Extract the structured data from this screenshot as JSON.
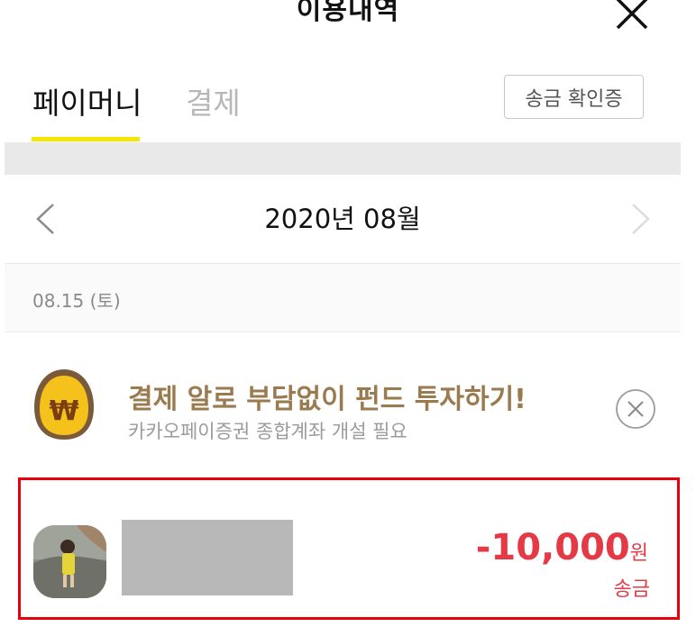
{
  "header": {
    "title": "이용내역"
  },
  "tabs": [
    {
      "label": "페이머니",
      "active": true
    },
    {
      "label": "결제",
      "active": false
    }
  ],
  "receipt_button": "송금 확인증",
  "month": {
    "label": "2020년 08월"
  },
  "date_group": {
    "label": "08.15 (토)"
  },
  "promo": {
    "title": "결제 알로 부담없이 펀드 투자하기!",
    "subtitle": "카카오페이증권 종합계좌 개설 필요",
    "icon": "won-coin-icon"
  },
  "transaction": {
    "amount": "-10,000",
    "currency": "원",
    "type": "송금"
  },
  "colors": {
    "accent_yellow": "#f7e600",
    "amount_red": "#e63946",
    "highlight_border": "#e8000d",
    "promo_brown": "#9a7a4f"
  }
}
